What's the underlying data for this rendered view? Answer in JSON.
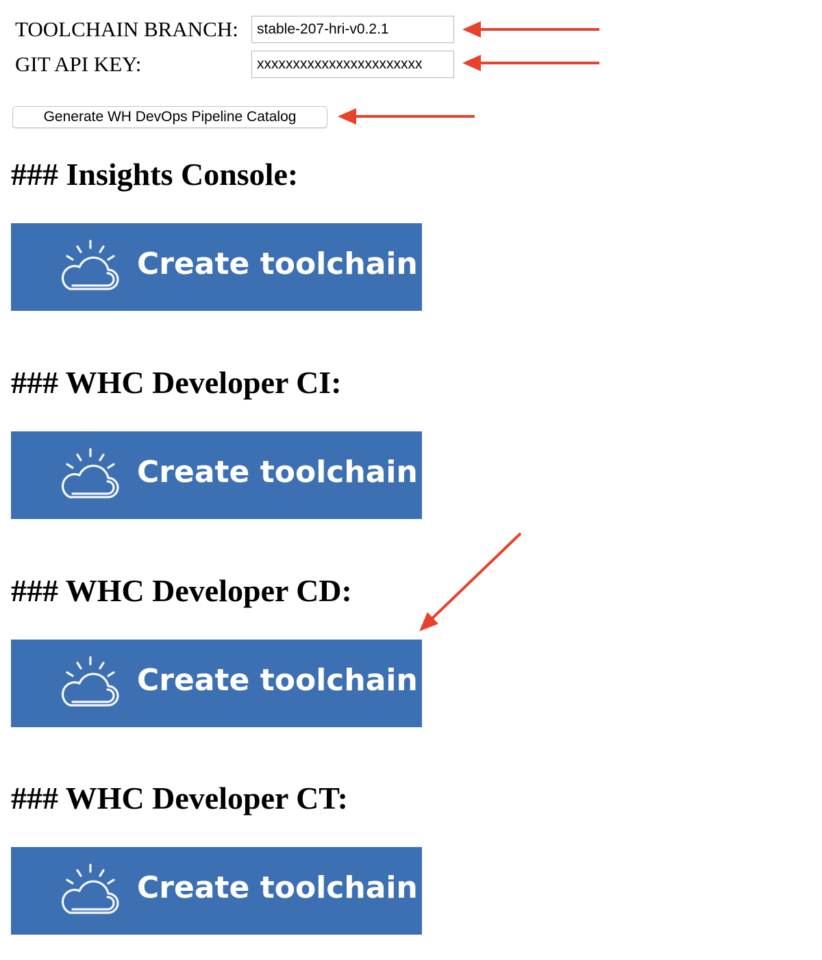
{
  "form": {
    "toolchain_branch": {
      "label": "TOOLCHAIN BRANCH:",
      "value": "stable-207-hri-v0.2.1"
    },
    "git_api_key": {
      "label": "GIT API KEY:",
      "value": "xxxxxxxxxxxxxxxxxxxxxxx"
    },
    "generate_button_label": "Generate WH DevOps Pipeline Catalog"
  },
  "sections": [
    {
      "heading": "### Insights Console:",
      "button_label": "Create toolchain"
    },
    {
      "heading": "### WHC Developer CI:",
      "button_label": "Create toolchain"
    },
    {
      "heading": "### WHC Developer CD:",
      "button_label": "Create toolchain"
    },
    {
      "heading": "### WHC Developer CT:",
      "button_label": "Create toolchain"
    }
  ],
  "colors": {
    "toolchain_button_bg": "#3d70b2",
    "annotation_arrow": "#e8412c"
  },
  "icons": {
    "toolchain_button": "cloud-sun-icon",
    "annotation": "red-arrow-icon"
  }
}
